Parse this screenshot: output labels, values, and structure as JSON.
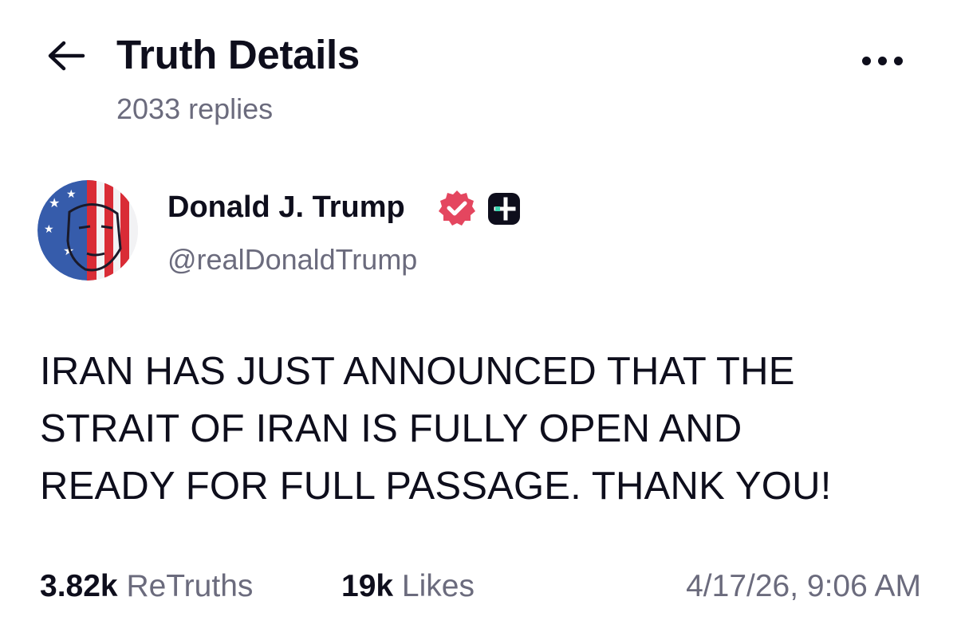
{
  "header": {
    "title": "Truth Details",
    "replies": "2033 replies",
    "back_icon": "arrow-left-icon",
    "more_icon": "ellipsis-horizontal-icon"
  },
  "author": {
    "name": "Donald J. Trump",
    "handle": "@realDonaldTrump",
    "verified_icon": "verified-badge-icon",
    "badge_icon": "plus-badge-icon"
  },
  "post": {
    "text": "IRAN HAS JUST ANNOUNCED THAT THE\nSTRAIT OF IRAN IS FULLY OPEN AND\nREADY FOR FULL PASSAGE. THANK YOU!"
  },
  "stats": {
    "retruths_count": "3.82k",
    "retruths_label": "ReTruths",
    "likes_count": "19k",
    "likes_label": "Likes",
    "timestamp": "4/17/26, 9:06 AM"
  },
  "colors": {
    "text_primary": "#0e0e1c",
    "text_secondary": "#6b6b7d",
    "verified_badge": "#e4465f",
    "background": "#ffffff"
  }
}
